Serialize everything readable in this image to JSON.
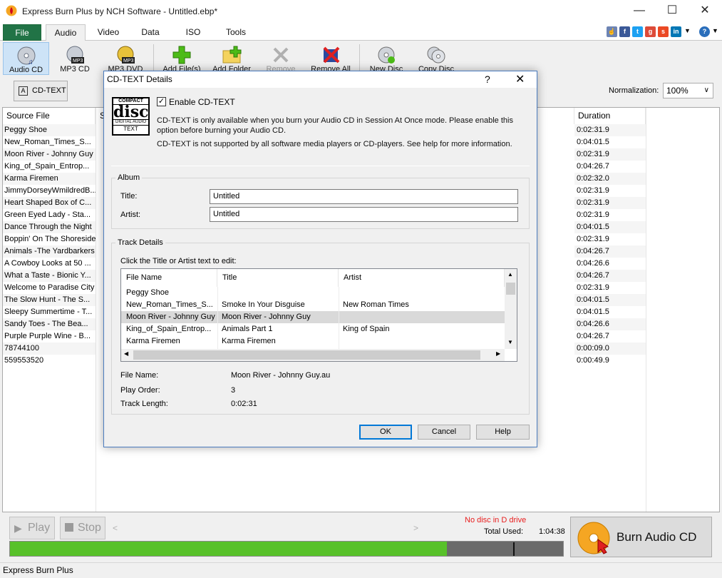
{
  "window": {
    "title": "Express Burn Plus by NCH Software - Untitled.ebp*"
  },
  "tabs": [
    {
      "label": "File"
    },
    {
      "label": "Audio"
    },
    {
      "label": "Video"
    },
    {
      "label": "Data"
    },
    {
      "label": "ISO"
    },
    {
      "label": "Tools"
    }
  ],
  "social": {
    "icons": [
      "thumbs-up",
      "facebook",
      "twitter",
      "google-plus",
      "stumbleupon",
      "linkedin"
    ],
    "help": "?"
  },
  "toolbar": {
    "audio_cd": "Audio CD",
    "mp3_cd": "MP3 CD",
    "mp3_dvd": "MP3 DVD",
    "add_files": "Add File(s)",
    "add_folder": "Add Folder",
    "remove": "Remove",
    "remove_all": "Remove All",
    "new_disc": "New Disc",
    "copy_disc": "Copy Disc"
  },
  "subbar": {
    "cdtext": "CD-TEXT",
    "normalization_label": "Normalization:",
    "normalization_value": "100%"
  },
  "list": {
    "col_source": "Source File",
    "col_s": "S",
    "col_duration": "Duration",
    "rows": [
      {
        "src": "Peggy Shoe",
        "dur": "0:02:31.9"
      },
      {
        "src": "New_Roman_Times_S...",
        "dur": "0:04:01.5"
      },
      {
        "src": "Moon River - Johnny Guy",
        "dur": "0:02:31.9"
      },
      {
        "src": "King_of_Spain_Entrop...",
        "dur": "0:04:26.7"
      },
      {
        "src": "Karma Firemen",
        "dur": "0:02:32.0"
      },
      {
        "src": "JimmyDorseyWmildredB...",
        "dur": "0:02:31.9"
      },
      {
        "src": "Heart Shaped Box of C...",
        "dur": "0:02:31.9"
      },
      {
        "src": "Green Eyed Lady - Sta...",
        "dur": "0:02:31.9"
      },
      {
        "src": "Dance Through the Night",
        "dur": "0:04:01.5"
      },
      {
        "src": "Boppin' On The Shoreside",
        "dur": "0:02:31.9"
      },
      {
        "src": "Animals -The Yardbarkers",
        "dur": "0:04:26.7"
      },
      {
        "src": "A Cowboy Looks at 50 ...",
        "dur": "0:04:26.6"
      },
      {
        "src": "What a Taste - Bionic Y...",
        "dur": "0:04:26.7"
      },
      {
        "src": "Welcome to Paradise City",
        "dur": "0:02:31.9"
      },
      {
        "src": "The Slow Hunt - The S...",
        "dur": "0:04:01.5"
      },
      {
        "src": "Sleepy Summertime - T...",
        "dur": "0:04:01.5"
      },
      {
        "src": "Sandy Toes - The Bea...",
        "dur": "0:04:26.6"
      },
      {
        "src": "Purple Purple Wine - B...",
        "dur": "0:04:26.7"
      },
      {
        "src": "78744100",
        "dur": "0:00:09.0"
      },
      {
        "src": "559553520",
        "dur": "0:00:49.9"
      }
    ]
  },
  "player": {
    "play": "Play",
    "stop": "Stop",
    "scroll_left": "<",
    "scroll_right": ">"
  },
  "status": {
    "no_disc": "No disc in D drive",
    "total_label": "Total Used:",
    "total_value": "1:04:38",
    "progress_fraction": 0.79
  },
  "burn": {
    "label": "Burn Audio CD"
  },
  "statusbar": {
    "text": "Express Burn Plus"
  },
  "dialog": {
    "title": "CD-TEXT Details",
    "help": "?",
    "close": "✕",
    "logo": {
      "top": "COMPACT",
      "main": "disc",
      "sub": "DIGITAL AUDIO",
      "foot": "TEXT"
    },
    "enable_label": "Enable CD-TEXT",
    "enabled": true,
    "info1": "CD-TEXT is only available when you burn your Audio CD in Session At Once mode.  Please enable this option before burning your Audio CD.",
    "info2": "CD-TEXT is not supported by all software media players or CD-players.  See help for more information.",
    "album_group": "Album",
    "title_label": "Title:",
    "title_value": "Untitled",
    "artist_label": "Artist:",
    "artist_value": "Untitled",
    "track_group": "Track Details",
    "track_hint": "Click the Title or Artist text to edit:",
    "table_headers": [
      "File Name",
      "Title",
      "Artist"
    ],
    "table_rows": [
      {
        "file": "Peggy Shoe",
        "title": "",
        "artist": ""
      },
      {
        "file": "New_Roman_Times_S...",
        "title": "Smoke In Your Disguise",
        "artist": "New Roman Times"
      },
      {
        "file": "Moon River - Johnny Guy",
        "title": "Moon River - Johnny Guy",
        "artist": ""
      },
      {
        "file": "King_of_Spain_Entrop...",
        "title": "Animals Part 1",
        "artist": "King of Spain"
      },
      {
        "file": "Karma Firemen",
        "title": "Karma Firemen",
        "artist": ""
      }
    ],
    "selected_row": 2,
    "file_name_label": "File Name:",
    "file_name_value": "Moon River - Johnny Guy.au",
    "play_order_label": "Play Order:",
    "play_order_value": "3",
    "track_length_label": "Track Length:",
    "track_length_value": "0:02:31",
    "ok": "OK",
    "cancel": "Cancel",
    "help_btn": "Help"
  }
}
